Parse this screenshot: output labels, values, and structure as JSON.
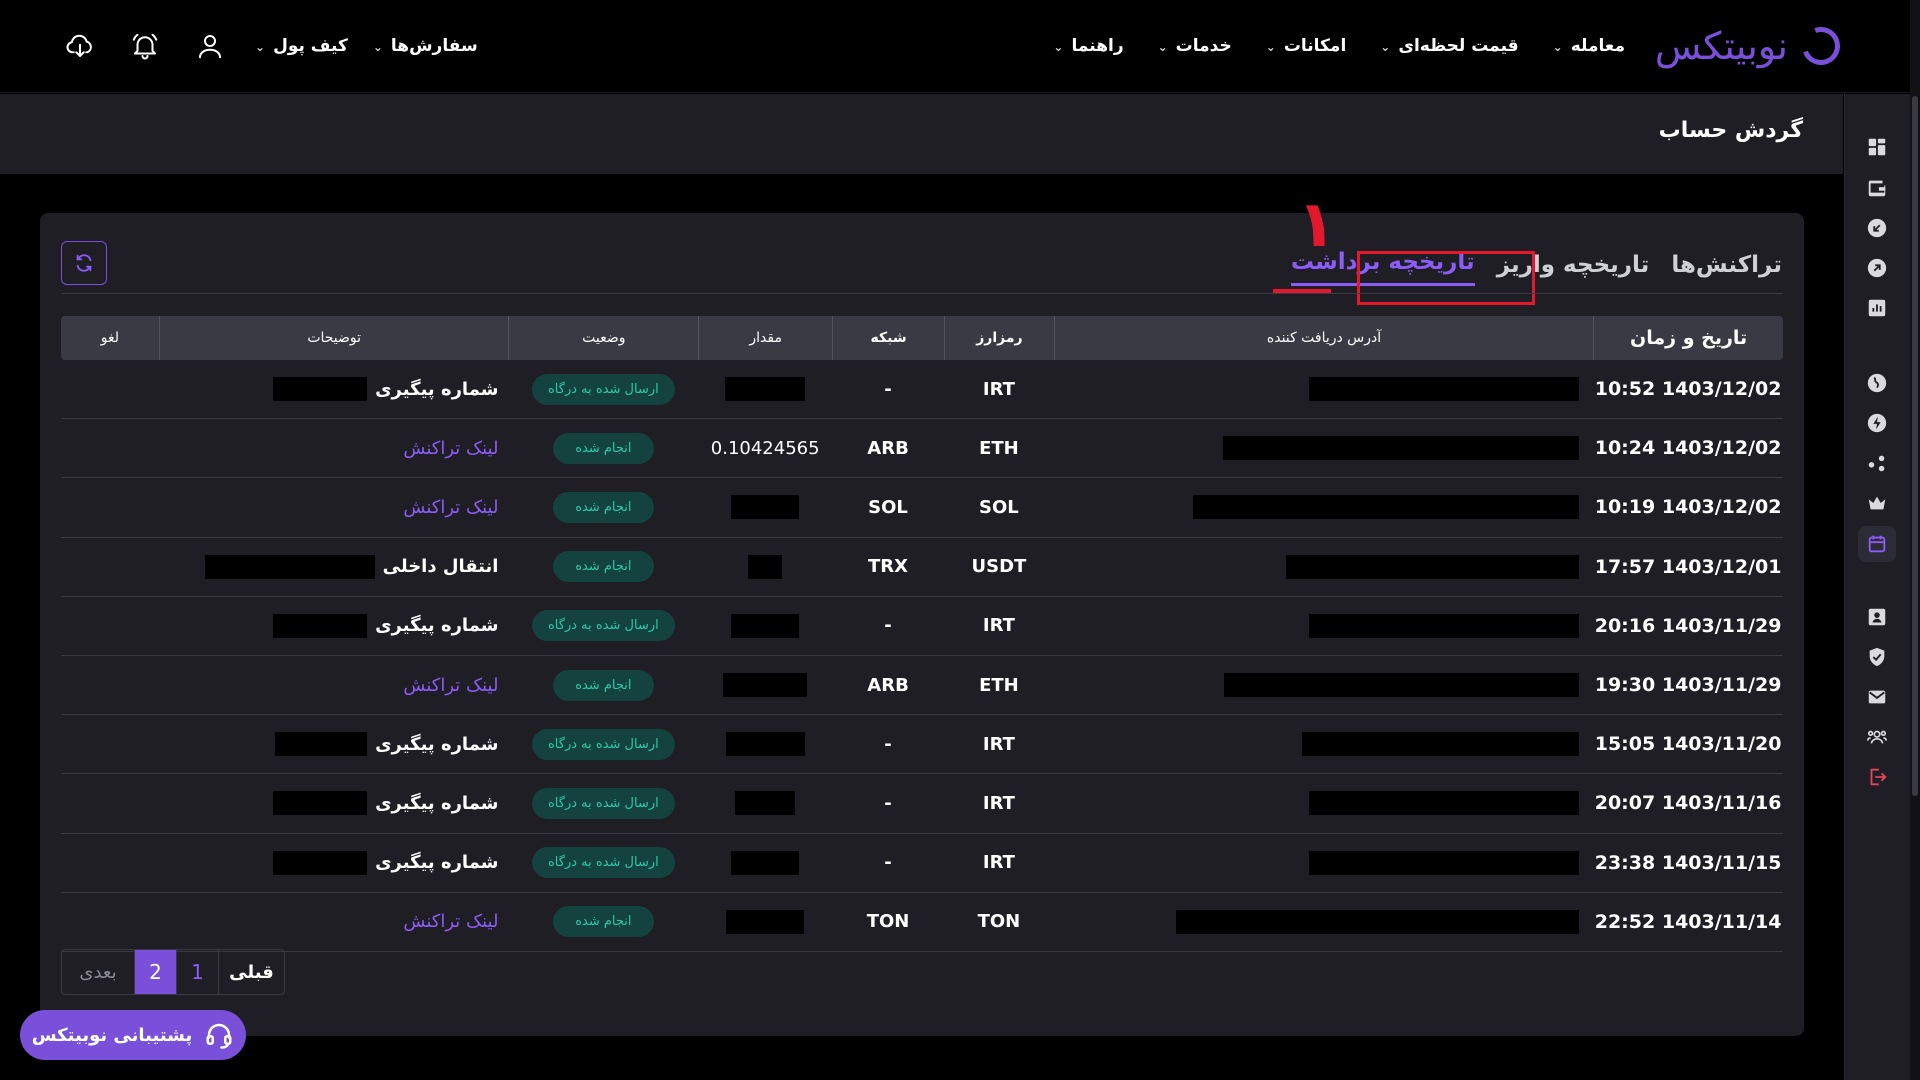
{
  "brand": {
    "name": "نوبیتکس",
    "color": "#7a4fd9"
  },
  "nav": {
    "items": [
      "معامله",
      "قیمت لحظه‌ای",
      "امکانات",
      "خدمات",
      "راهنما"
    ],
    "orders": "سفارش‌ها",
    "wallet": "کیف پول",
    "icons": [
      "user-icon",
      "bell-icon",
      "cloud-download-icon"
    ]
  },
  "page": {
    "title": "گردش حساب"
  },
  "tabs": [
    "تراکنش‌ها",
    "تاریخچه واریز",
    "تاریخچه برداشت"
  ],
  "active_tab_index": 2,
  "annotation": {
    "number": "۱"
  },
  "table": {
    "headers": {
      "date": "تاریخ و زمان",
      "address": "آدرس دریافت کننده",
      "coin": "رمزارز",
      "network": "شبکه",
      "amount": "مقدار",
      "status": "وضعیت",
      "description": "توضیحات",
      "cancel": "لغو"
    },
    "rows": [
      {
        "date": "1403/12/02 10:52",
        "coin": "IRT",
        "network": "-",
        "amount": "",
        "status": "ارسال شده به درگاه",
        "desc_label": "شماره پیگیری",
        "desc_type": "label"
      },
      {
        "date": "1403/12/02 10:24",
        "coin": "ETH",
        "network": "ARB",
        "amount": "0.10424565",
        "status": "انجام شده",
        "desc_label": "لینک تراکنش",
        "desc_type": "link"
      },
      {
        "date": "1403/12/02 10:19",
        "coin": "SOL",
        "network": "SOL",
        "amount": "",
        "status": "انجام شده",
        "desc_label": "لینک تراکنش",
        "desc_type": "link"
      },
      {
        "date": "1403/12/01 17:57",
        "coin": "USDT",
        "network": "TRX",
        "amount": "",
        "status": "انجام شده",
        "desc_label": "انتقال داخلی",
        "desc_type": "label"
      },
      {
        "date": "1403/11/29 20:16",
        "coin": "IRT",
        "network": "-",
        "amount": "",
        "status": "ارسال شده به درگاه",
        "desc_label": "شماره پیگیری",
        "desc_type": "label"
      },
      {
        "date": "1403/11/29 19:30",
        "coin": "ETH",
        "network": "ARB",
        "amount": "",
        "status": "انجام شده",
        "desc_label": "لینک تراکنش",
        "desc_type": "link"
      },
      {
        "date": "1403/11/20 15:05",
        "coin": "IRT",
        "network": "-",
        "amount": "",
        "status": "ارسال شده به درگاه",
        "desc_label": "شماره پیگیری",
        "desc_type": "label"
      },
      {
        "date": "1403/11/16 20:07",
        "coin": "IRT",
        "network": "-",
        "amount": "",
        "status": "ارسال شده به درگاه",
        "desc_label": "شماره پیگیری",
        "desc_type": "label"
      },
      {
        "date": "1403/11/15 23:38",
        "coin": "IRT",
        "network": "-",
        "amount": "",
        "status": "ارسال شده به درگاه",
        "desc_label": "شماره پیگیری",
        "desc_type": "label"
      },
      {
        "date": "1403/11/14 22:52",
        "coin": "TON",
        "network": "TON",
        "amount": "",
        "status": "انجام شده",
        "desc_label": "لینک تراکنش",
        "desc_type": "link"
      }
    ]
  },
  "pagination": {
    "prev": "قبلی",
    "pages": [
      "1",
      "2"
    ],
    "current": "2",
    "next": "بعدی"
  },
  "support": {
    "label": "پشتیبانی نوبیتکس"
  },
  "sidebar_icons": [
    "dashboard-icon",
    "wallet-icon",
    "deposit-icon",
    "withdraw-icon",
    "chart-icon",
    "globe-icon",
    "lightning-icon",
    "share-icon",
    "crown-icon",
    "calendar-icon",
    "profile-icon",
    "shield-icon",
    "mail-icon",
    "users-icon",
    "logout-icon"
  ],
  "colors": {
    "accent": "#8b5cf6",
    "badge_bg": "#14423e",
    "badge_fg": "#2cc9a8",
    "annotation": "#e3182d"
  }
}
